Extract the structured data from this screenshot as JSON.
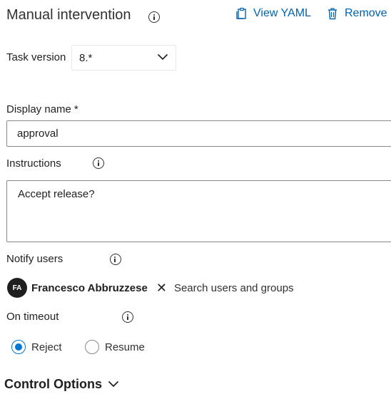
{
  "header": {
    "title": "Manual intervention",
    "view_yaml_label": "View YAML",
    "remove_label": "Remove",
    "accent_color": "#0063b1"
  },
  "task_version": {
    "label": "Task version",
    "value": "8.*"
  },
  "display_name": {
    "label": "Display name",
    "required_marker": "*",
    "value": "approval"
  },
  "instructions": {
    "label": "Instructions",
    "value": "Accept release?"
  },
  "notify_users": {
    "label": "Notify users",
    "selected_user": {
      "initials": "FA",
      "name": "Francesco Abbruzzese"
    },
    "remove_glyph": "✕",
    "placeholder": "Search users and groups"
  },
  "on_timeout": {
    "label": "On timeout",
    "options": [
      {
        "label": "Reject",
        "selected": true
      },
      {
        "label": "Resume",
        "selected": false
      }
    ],
    "selected_color": "#0078d4"
  },
  "control_options": {
    "label": "Control Options"
  }
}
